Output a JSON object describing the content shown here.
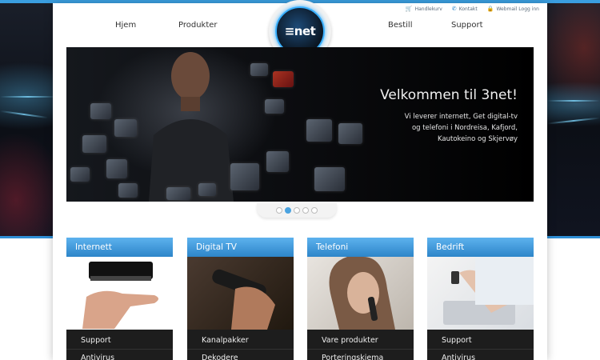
{
  "utility_links": [
    {
      "label": "Handlekurv",
      "icon": "cart-icon"
    },
    {
      "label": "Kontakt",
      "icon": "phone-icon"
    },
    {
      "label": "Webmail Logg inn",
      "icon": "lock-icon"
    }
  ],
  "nav": {
    "home": "Hjem",
    "products": "Produkter",
    "order": "Bestill",
    "support": "Support"
  },
  "logo": {
    "text": "≡net"
  },
  "hero": {
    "title": "Velkommen til 3net!",
    "text": "Vi leverer internett, Get digital-tv og telefoni i Nordreisa, Kafjord, Kautokeino og Skjervøy"
  },
  "slider": {
    "count": 5,
    "active": 1
  },
  "cards": [
    {
      "title": "Internett",
      "links": [
        "Support",
        "Antivirus"
      ]
    },
    {
      "title": "Digital TV",
      "links": [
        "Kanalpakker",
        "Dekodere"
      ]
    },
    {
      "title": "Telefoni",
      "links": [
        "Vare produkter",
        "Porteringskjema"
      ]
    },
    {
      "title": "Bedrift",
      "links": [
        "Support",
        "Antivirus"
      ]
    }
  ],
  "colors": {
    "accent": "#2d85c9",
    "brand_glow": "#3ab0ff"
  }
}
